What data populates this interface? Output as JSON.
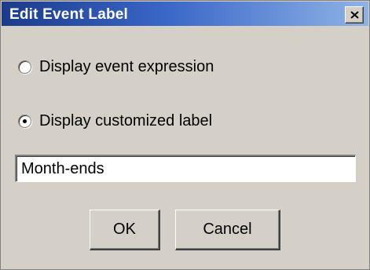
{
  "window": {
    "title": "Edit Event Label",
    "close_icon": "close-icon"
  },
  "options": [
    {
      "label": "Display event expression",
      "checked": false
    },
    {
      "label": "Display customized label",
      "checked": true
    }
  ],
  "label_input": {
    "value": "Month-ends"
  },
  "buttons": {
    "ok": "OK",
    "cancel": "Cancel"
  }
}
